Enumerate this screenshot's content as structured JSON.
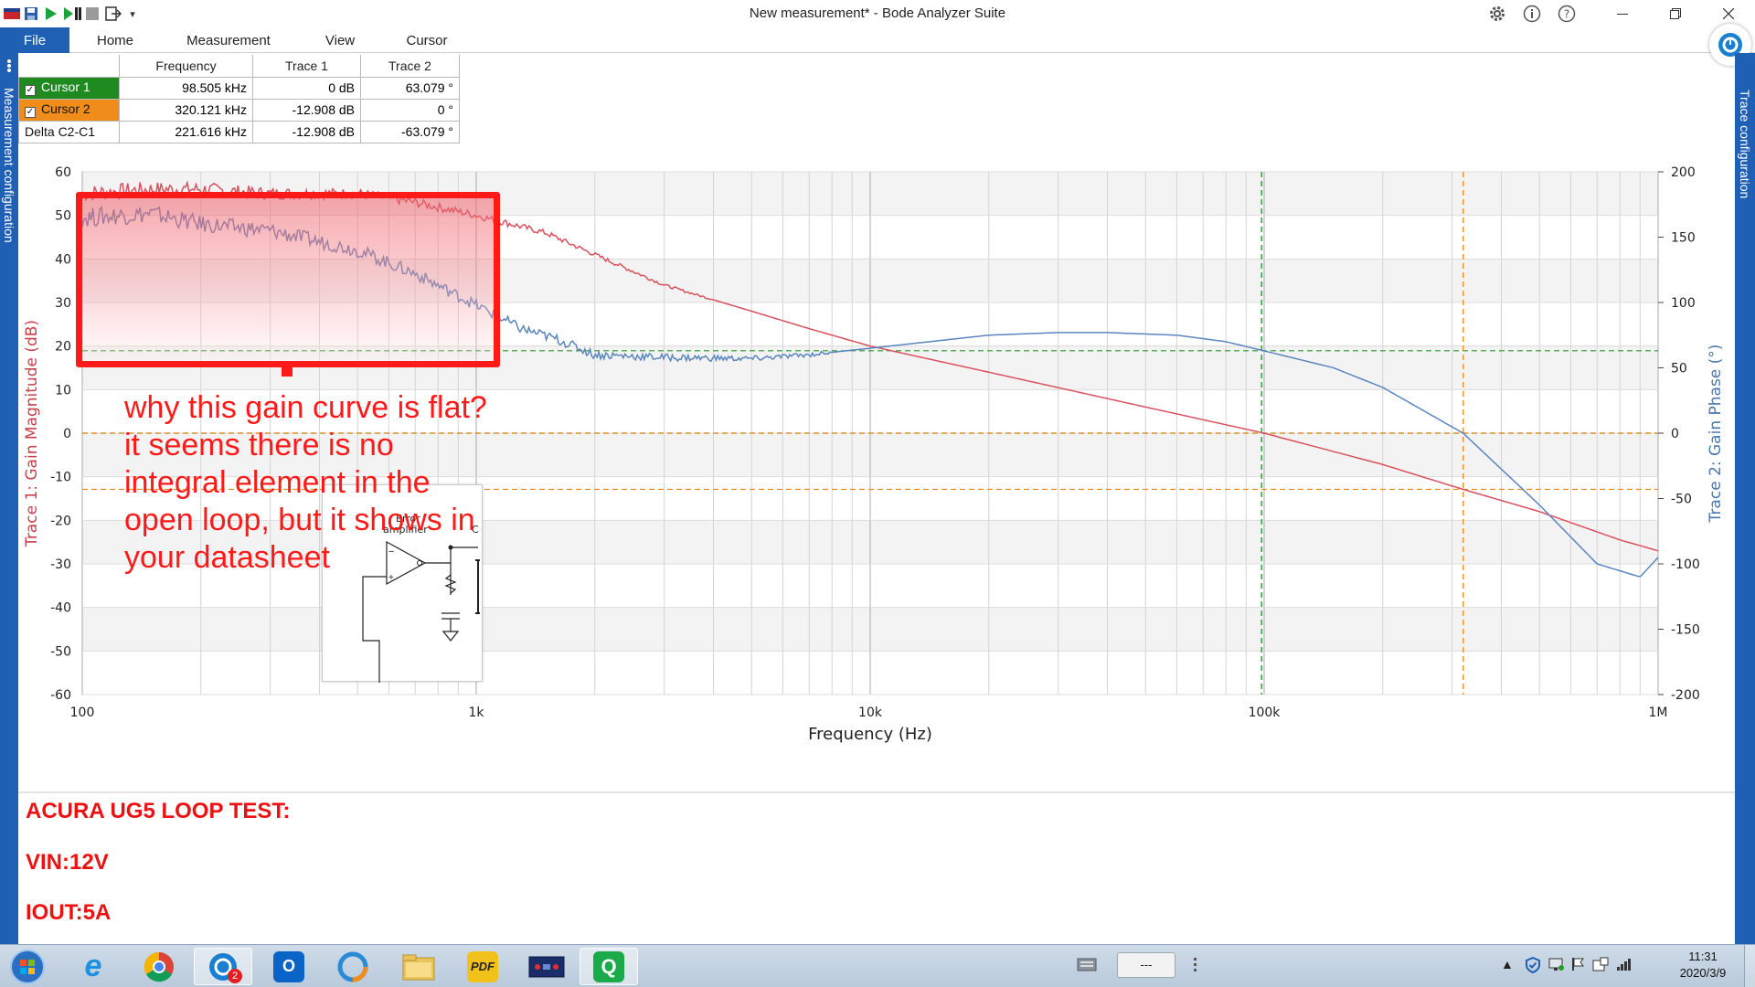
{
  "window": {
    "title": "New measurement* - Bode Analyzer Suite",
    "help_icon": "question-icon",
    "info_icon": "info-icon",
    "settings_icon": "gear-icon"
  },
  "ribbon": {
    "tabs": [
      "File",
      "Home",
      "Measurement",
      "View",
      "Cursor"
    ]
  },
  "side_panels": {
    "left": "Measurement configuration",
    "right": "Trace configuration"
  },
  "cursor_table": {
    "headers": [
      "Frequency",
      "Trace 1",
      "Trace 2"
    ],
    "rows": [
      {
        "name": "Cursor 1",
        "frequency": "98.505 kHz",
        "trace1": "0 dB",
        "trace2": "63.079 °",
        "checked": true,
        "color": "#1f8a1f"
      },
      {
        "name": "Cursor 2",
        "frequency": "320.121 kHz",
        "trace1": "-12.908 dB",
        "trace2": "0 °",
        "checked": true,
        "color": "#f08c1a"
      },
      {
        "name": "Delta C2-C1",
        "frequency": "221.616 kHz",
        "trace1": "-12.908 dB",
        "trace2": "-63.079 °"
      }
    ]
  },
  "chart_data": {
    "type": "line",
    "xlabel": "Frequency (Hz)",
    "ylabel_left": "Trace 1: Gain Magnitude (dB)",
    "ylabel_right": "Trace 2: Gain Phase (°)",
    "x_scale": "log",
    "xlim": [
      100,
      1000000
    ],
    "x_ticks": [
      "100",
      "1k",
      "10k",
      "100k",
      "1M"
    ],
    "ylim_left": [
      -60,
      60
    ],
    "y_ticks_left": [
      "60",
      "50",
      "40",
      "30",
      "20",
      "10",
      "0",
      "-10",
      "-20",
      "-30",
      "-40",
      "-50",
      "-60"
    ],
    "ylim_right": [
      -200,
      200
    ],
    "y_ticks_right": [
      "200",
      "150",
      "100",
      "50",
      "0",
      "-50",
      "-100",
      "-150",
      "-200"
    ],
    "grid": true,
    "series": [
      {
        "name": "Trace 1",
        "axis": "left",
        "color": "#d9505e",
        "x": [
          100,
          150,
          200,
          300,
          500,
          700,
          1000,
          1500,
          2000,
          3000,
          5000,
          7000,
          10000,
          20000,
          50000,
          100000,
          200000,
          320000,
          500000,
          800000,
          1000000
        ],
        "y": [
          55,
          56,
          56,
          55,
          55,
          53,
          50,
          46,
          41,
          34,
          28,
          24,
          20,
          14,
          6,
          0,
          -7.2,
          -12.9,
          -18,
          -24.5,
          -27
        ]
      },
      {
        "name": "Trace 2",
        "axis": "right",
        "color": "#5a86bd",
        "x": [
          100,
          150,
          200,
          300,
          500,
          700,
          1000,
          1300,
          1600,
          2000,
          3000,
          5000,
          7000,
          10000,
          20000,
          30000,
          40000,
          60000,
          80000,
          100000,
          150000,
          200000,
          320000,
          500000,
          700000,
          900000,
          1000000
        ],
        "y": [
          165,
          168,
          160,
          155,
          140,
          122,
          98,
          80,
          72,
          60,
          58,
          57,
          60,
          65,
          75,
          77,
          77,
          75,
          70,
          63,
          50,
          35,
          0,
          -55,
          -100,
          -110,
          -95
        ]
      }
    ],
    "cursors": [
      {
        "name": "Cursor 1",
        "x": 98505,
        "y_left": 0,
        "y_right": 63.079,
        "color": "#2a9a2a"
      },
      {
        "name": "Cursor 2",
        "x": 320121,
        "y_left": -12.908,
        "y_right": 0,
        "color": "#f08c1a"
      }
    ]
  },
  "annotation": {
    "lines": [
      "why this gain curve is flat?",
      "it seems there is no",
      "integral element in the",
      "open loop, but it shows in",
      "your datasheet"
    ],
    "schematic_labels": [
      "Error",
      "amplifier",
      "C"
    ]
  },
  "notes": [
    "ACURA UG5 LOOP TEST:",
    "VIN:12V",
    "IOUT:5A"
  ],
  "taskbar": {
    "apps": [
      "start-orb",
      "internet-explorer",
      "chrome",
      "bode-analyzer",
      "outlook",
      "webex",
      "file-explorer",
      "pdf-reader",
      "device-app",
      "qlik"
    ],
    "bode_badge": "2",
    "tray_box": "---",
    "time": "11:31",
    "date": "2020/3/9"
  }
}
